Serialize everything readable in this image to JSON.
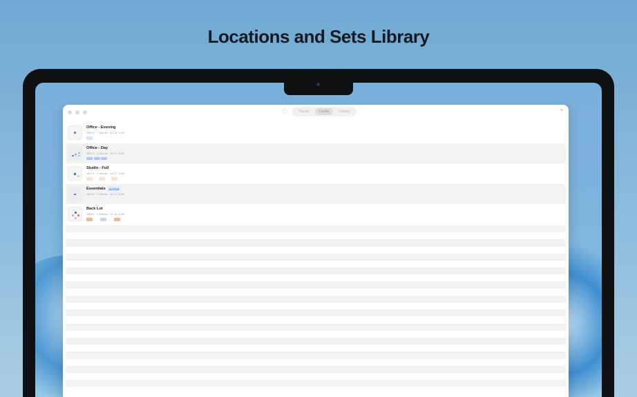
{
  "hero": {
    "title": "Locations and Sets Library"
  },
  "window": {
    "tabs": [
      {
        "label": "Studio",
        "active": false
      },
      {
        "label": "Looks",
        "active": true
      },
      {
        "label": "Library",
        "active": false
      }
    ],
    "add_label": "+",
    "view_icon": "lightbulb-icon"
  },
  "items": [
    {
      "name": "Office - Evening",
      "meta": "4983 K · 1 fixtures · Jul 25, 2026",
      "badge": "",
      "chip_colors": [
        "#d6e6fb"
      ],
      "dot_colors": [
        "#3d7be0"
      ]
    },
    {
      "name": "Office - Day",
      "meta": "5691 K · 6 fixtures · Jul 27, 2026",
      "badge": "",
      "chip_colors": [
        "#a9c8f3",
        "#a9c8f3",
        "#a9c8f3"
      ],
      "dot_colors": [
        "#3d7be0",
        "#5aa0f0",
        "#7ab3f3",
        "#8cc0f5"
      ]
    },
    {
      "name": "Studio - Full",
      "meta": "3800 K · 3 fixtures · Jul 27, 2026",
      "badge": "",
      "chip_colors": [
        "#fbe3c4",
        "#fbe3c4",
        "#fbe3c4"
      ],
      "dot_colors": [
        "#1f5fd0",
        "#f3c99a"
      ]
    },
    {
      "name": "Essentials",
      "meta": "6900 K · 3 fixtures · Jul 27, 2026",
      "badge": "ACTIVE",
      "chip_colors": [],
      "dot_colors": [
        "#2f6fe0"
      ]
    },
    {
      "name": "Back Lot",
      "meta": "4608 K · 3 fixtures · Jul 30, 2026",
      "badge": "",
      "chip_colors": [
        "#f7b582",
        "#c5d8f8",
        "#f7b582"
      ],
      "dot_colors": [
        "#2f6fe0",
        "#f3a06a",
        "#e86b5a",
        "#c9b6f0"
      ]
    }
  ]
}
